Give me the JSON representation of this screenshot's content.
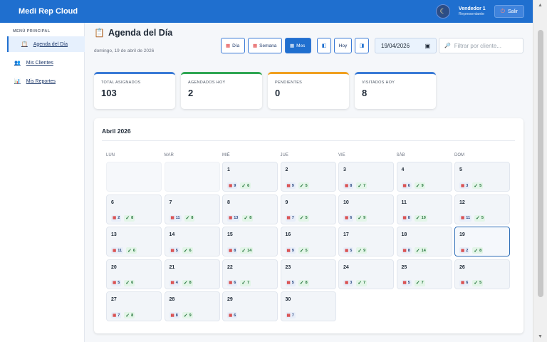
{
  "app": {
    "title": "Medi Rep Cloud"
  },
  "header": {
    "user_name": "Vendedor 1",
    "user_role": "Representante",
    "logout_label": "Salir",
    "theme_icon": "moon-icon",
    "logout_icon": "logout-icon"
  },
  "sidebar": {
    "section_title": "MENÚ PRINCIPAL",
    "items": [
      {
        "label": "Agenda del Día",
        "icon": "clipboard-icon"
      },
      {
        "label": "Mis Clientes",
        "icon": "users-icon"
      },
      {
        "label": "Mis Reportes",
        "icon": "chart-icon"
      }
    ]
  },
  "page": {
    "title": "Agenda del Día",
    "date_text": "domingo, 19 de abril de 2026"
  },
  "toolbar": {
    "view_day": "Día",
    "view_week": "Semana",
    "view_month": "Mes",
    "today": "Hoy",
    "date_value": "19/04/2026",
    "filter_placeholder": "Filtrar por cliente..."
  },
  "stats": [
    {
      "label": "TOTAL ASIGNADOS",
      "value": "103",
      "color": "#3a7ad6"
    },
    {
      "label": "AGENDADOS HOY",
      "value": "2",
      "color": "#2fa653"
    },
    {
      "label": "PENDIENTES",
      "value": "0",
      "color": "#f0a020"
    },
    {
      "label": "VISITADOS HOY",
      "value": "8",
      "color": "#3a7ad6"
    }
  ],
  "calendar": {
    "month_title": "Abril 2026",
    "weekdays": [
      "LUN",
      "MAR",
      "MIÉ",
      "JUE",
      "VIE",
      "SÁB",
      "DOM"
    ],
    "today": 19,
    "days": [
      {
        "d": "1",
        "a": "9",
        "v": "6"
      },
      {
        "d": "2",
        "a": "9",
        "v": "5"
      },
      {
        "d": "3",
        "a": "8",
        "v": "7"
      },
      {
        "d": "4",
        "a": "6",
        "v": "9"
      },
      {
        "d": "5",
        "a": "3",
        "v": "5"
      },
      {
        "d": "6",
        "a": "2",
        "v": "8"
      },
      {
        "d": "7",
        "a": "11",
        "v": "8"
      },
      {
        "d": "8",
        "a": "13",
        "v": "8"
      },
      {
        "d": "9",
        "a": "7",
        "v": "5"
      },
      {
        "d": "10",
        "a": "6",
        "v": "9"
      },
      {
        "d": "11",
        "a": "8",
        "v": "10"
      },
      {
        "d": "12",
        "a": "11",
        "v": "5"
      },
      {
        "d": "13",
        "a": "11",
        "v": "6"
      },
      {
        "d": "14",
        "a": "5",
        "v": "6"
      },
      {
        "d": "15",
        "a": "8",
        "v": "14"
      },
      {
        "d": "16",
        "a": "9",
        "v": "5"
      },
      {
        "d": "17",
        "a": "5",
        "v": "9"
      },
      {
        "d": "18",
        "a": "8",
        "v": "14"
      },
      {
        "d": "19",
        "a": "2",
        "v": "8"
      },
      {
        "d": "20",
        "a": "5",
        "v": "6"
      },
      {
        "d": "21",
        "a": "4",
        "v": "8"
      },
      {
        "d": "22",
        "a": "6",
        "v": "7"
      },
      {
        "d": "23",
        "a": "5",
        "v": "8"
      },
      {
        "d": "24",
        "a": "3",
        "v": "7"
      },
      {
        "d": "25",
        "a": "5",
        "v": "7"
      },
      {
        "d": "26",
        "a": "6",
        "v": "5"
      },
      {
        "d": "27",
        "a": "7",
        "v": "8"
      },
      {
        "d": "28",
        "a": "8",
        "v": "9"
      },
      {
        "d": "29",
        "a": "6",
        "v": null
      },
      {
        "d": "30",
        "a": "7",
        "v": null
      }
    ]
  }
}
